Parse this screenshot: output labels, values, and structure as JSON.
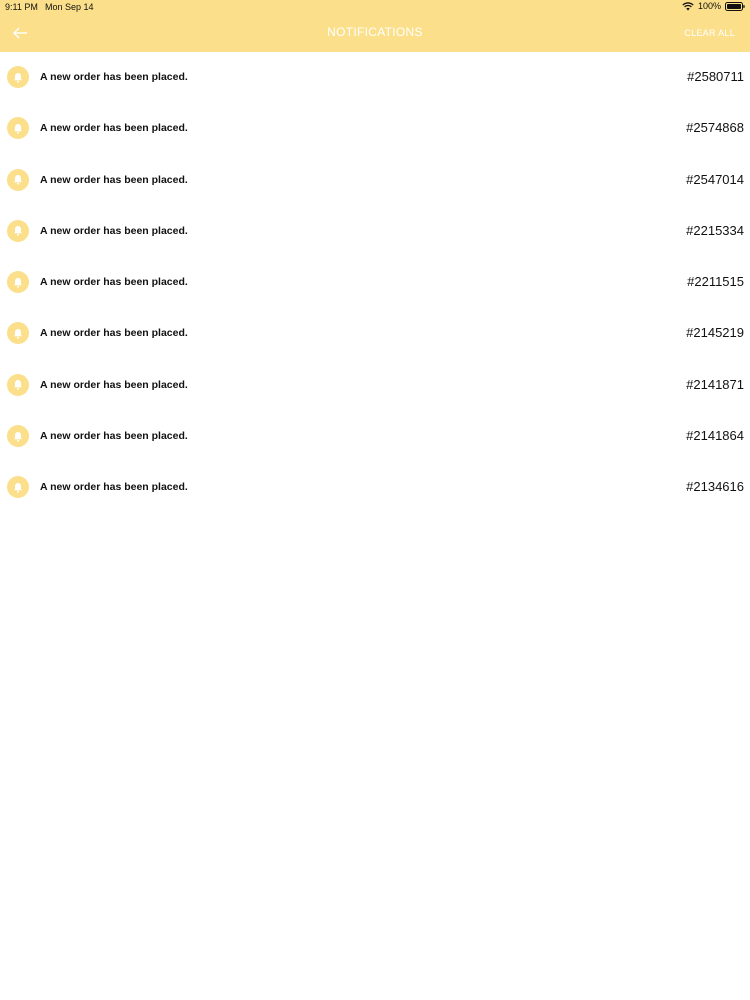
{
  "status_bar": {
    "time": "9:11 PM",
    "date": "Mon Sep 14",
    "battery": "100%"
  },
  "header": {
    "title": "NOTIFICATIONS",
    "clear_all": "CLEAR ALL",
    "background_color": "#fbdf8a"
  },
  "icons": {
    "back": "arrow-left-icon",
    "notification": "bell-icon",
    "wifi": "wifi-icon",
    "battery": "battery-icon"
  },
  "notifications": [
    {
      "message": "A new order has been placed.",
      "order_id": "#2580711"
    },
    {
      "message": "A new order has been placed.",
      "order_id": "#2574868"
    },
    {
      "message": "A new order has been placed.",
      "order_id": "#2547014"
    },
    {
      "message": "A new order has been placed.",
      "order_id": "#2215334"
    },
    {
      "message": "A new order has been placed.",
      "order_id": "#2211515"
    },
    {
      "message": "A new order has been placed.",
      "order_id": "#2145219"
    },
    {
      "message": "A new order has been placed.",
      "order_id": "#2141871"
    },
    {
      "message": "A new order has been placed.",
      "order_id": "#2141864"
    },
    {
      "message": "A new order has been placed.",
      "order_id": "#2134616"
    }
  ]
}
